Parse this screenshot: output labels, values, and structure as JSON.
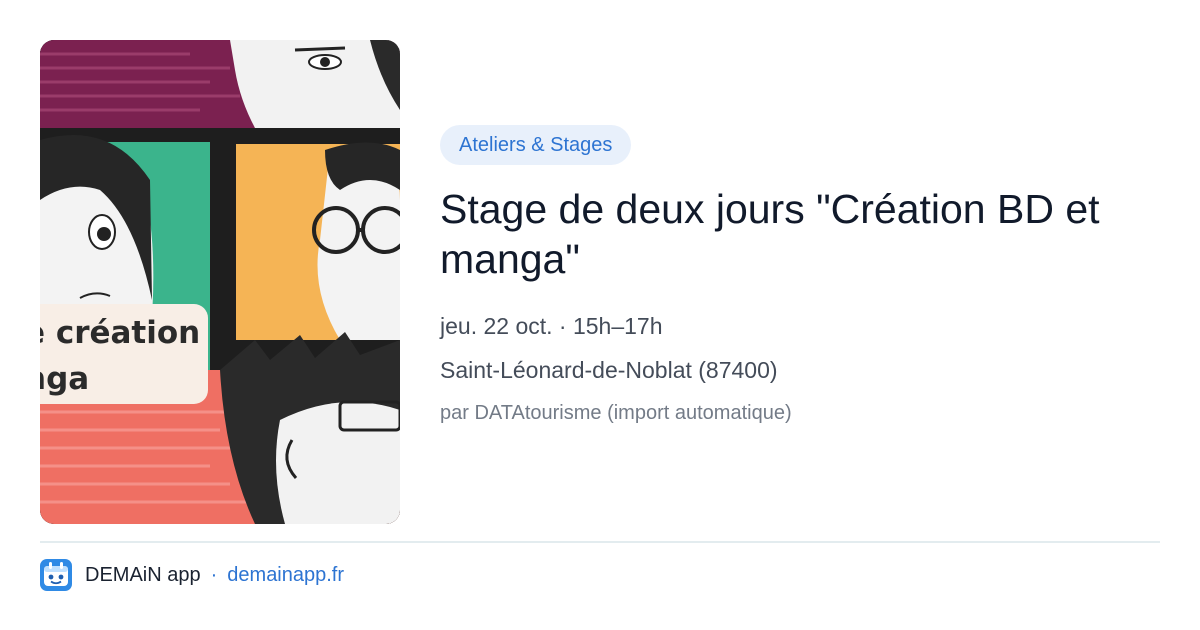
{
  "image": {
    "caption_lines": [
      "e création",
      "nga"
    ]
  },
  "event": {
    "category": "Ateliers & Stages",
    "title": "Stage de deux jours \"Création BD et manga\"",
    "datetime": "jeu. 22 oct. · 15h–17h",
    "location": "Saint-Léonard-de-Noblat (87400)",
    "source": "par DATAtourisme (import automatique)"
  },
  "footer": {
    "app_name": "DEMAiN app",
    "separator": "·",
    "url": "demainapp.fr",
    "logo_icon": "demain-app-logo-icon"
  },
  "colors": {
    "accent": "#2d74d2",
    "badge_bg": "#e8f0fb",
    "panel_purple": "#7b2150",
    "panel_green": "#3bb48c",
    "panel_yellow": "#f5b455",
    "panel_coral": "#ef6f63"
  }
}
